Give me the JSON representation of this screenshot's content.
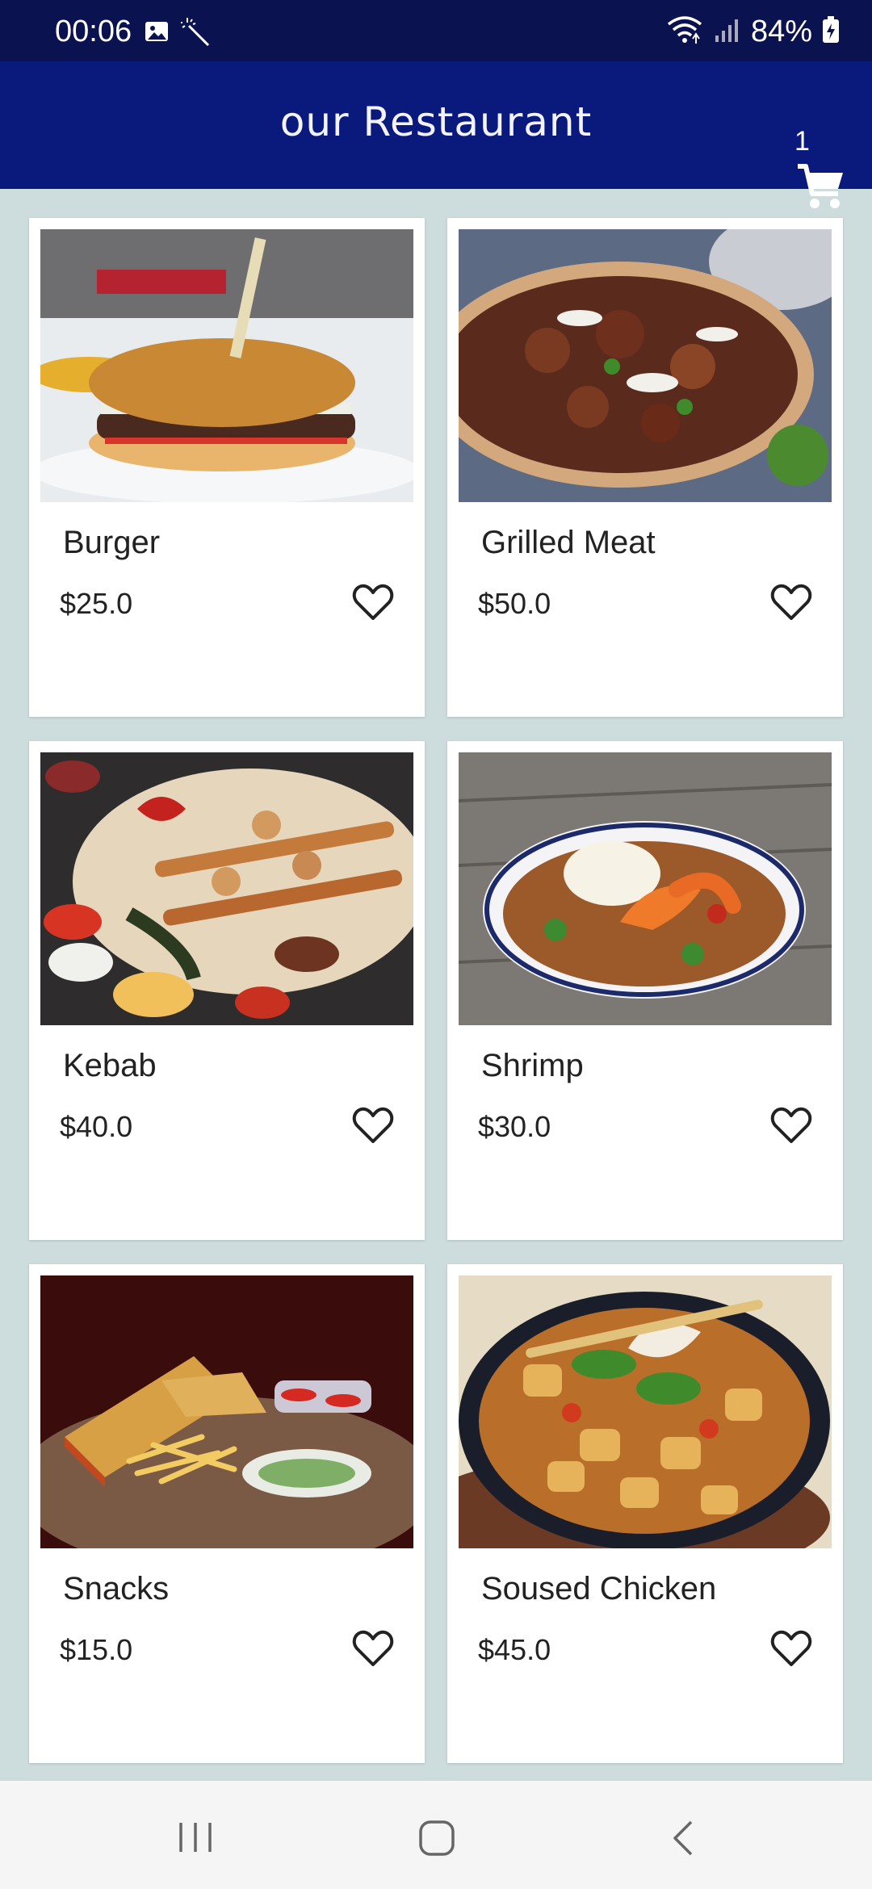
{
  "status_bar": {
    "time": "00:06",
    "battery": "84%",
    "icons": [
      "gallery-icon",
      "magic-wand-icon",
      "wifi-icon",
      "signal-icon",
      "battery-icon"
    ]
  },
  "app_bar": {
    "title": "our Restaurant",
    "cart_count": "1",
    "cart_icon": "shopping-cart-icon"
  },
  "items": [
    {
      "name": "Burger",
      "price": "$25.0",
      "image": "burger-photo"
    },
    {
      "name": "Grilled Meat",
      "price": "$50.0",
      "image": "grilled-meat-photo"
    },
    {
      "name": "Kebab",
      "price": "$40.0",
      "image": "kebab-photo"
    },
    {
      "name": "Shrimp",
      "price": "$30.0",
      "image": "shrimp-photo"
    },
    {
      "name": "Snacks",
      "price": "$15.0",
      "image": "snacks-photo"
    },
    {
      "name": "Soused Chicken",
      "price": "$45.0",
      "image": "soused-chicken-photo"
    }
  ],
  "nav_bar": {
    "buttons": [
      "recent-apps-icon",
      "home-icon",
      "back-icon"
    ]
  },
  "colors": {
    "status_bar": "#0a1250",
    "app_bar": "#0a1a7c",
    "background": "#cddcdc",
    "card": "#ffffff"
  }
}
